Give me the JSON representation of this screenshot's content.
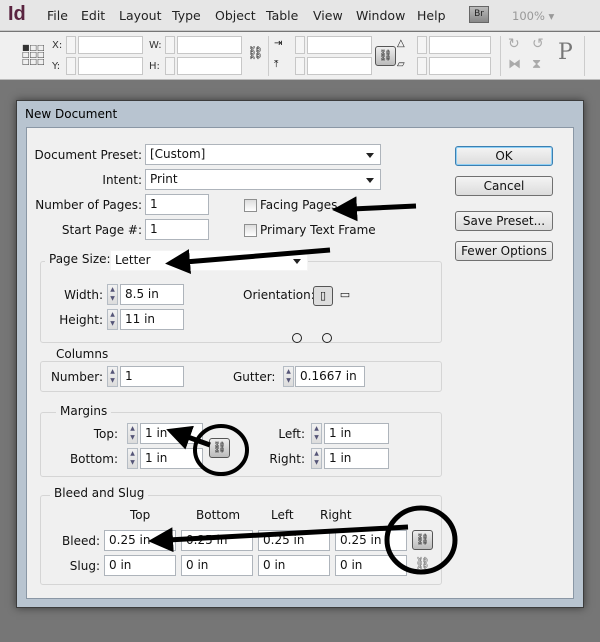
{
  "app": {
    "logo": "Id",
    "menu": [
      "File",
      "Edit",
      "Layout",
      "Type",
      "Object",
      "Table",
      "View",
      "Window",
      "Help"
    ],
    "bridge": "Br",
    "zoom": "100%"
  },
  "control_panel": {
    "x_label": "X:",
    "y_label": "Y:",
    "w_label": "W:",
    "h_label": "H:",
    "style_letter": "P"
  },
  "dialog": {
    "title": "New Document",
    "document_preset_label": "Document Preset:",
    "document_preset": "[Custom]",
    "intent_label": "Intent:",
    "intent": "Print",
    "num_pages_label": "Number of Pages:",
    "num_pages": "1",
    "start_page_label": "Start Page #:",
    "start_page": "1",
    "facing_pages_label": "Facing Pages",
    "facing_pages_checked": false,
    "primary_text_frame_label": "Primary Text Frame",
    "primary_text_frame_checked": false,
    "buttons": {
      "ok": "OK",
      "cancel": "Cancel",
      "save_preset": "Save Preset...",
      "fewer_options": "Fewer Options"
    },
    "page_size": {
      "label": "Page Size:",
      "value": "Letter",
      "width_label": "Width:",
      "width": "8.5 in",
      "height_label": "Height:",
      "height": "11 in",
      "orientation_label": "Orientation:",
      "orientation": "portrait"
    },
    "columns": {
      "title": "Columns",
      "number_label": "Number:",
      "number": "1",
      "gutter_label": "Gutter:",
      "gutter": "0.1667 in"
    },
    "margins": {
      "title": "Margins",
      "top_label": "Top:",
      "top": "1 in",
      "bottom_label": "Bottom:",
      "bottom": "1 in",
      "left_label": "Left:",
      "left": "1 in",
      "right_label": "Right:",
      "right": "1 in"
    },
    "bleed_slug": {
      "title": "Bleed and Slug",
      "headers": [
        "Top",
        "Bottom",
        "Left",
        "Right"
      ],
      "bleed_label": "Bleed:",
      "bleed": [
        "0.25 in",
        "0.25 in",
        "0.25 in",
        "0.25 in"
      ],
      "slug_label": "Slug:",
      "slug": [
        "0 in",
        "0 in",
        "0 in",
        "0 in"
      ]
    }
  }
}
